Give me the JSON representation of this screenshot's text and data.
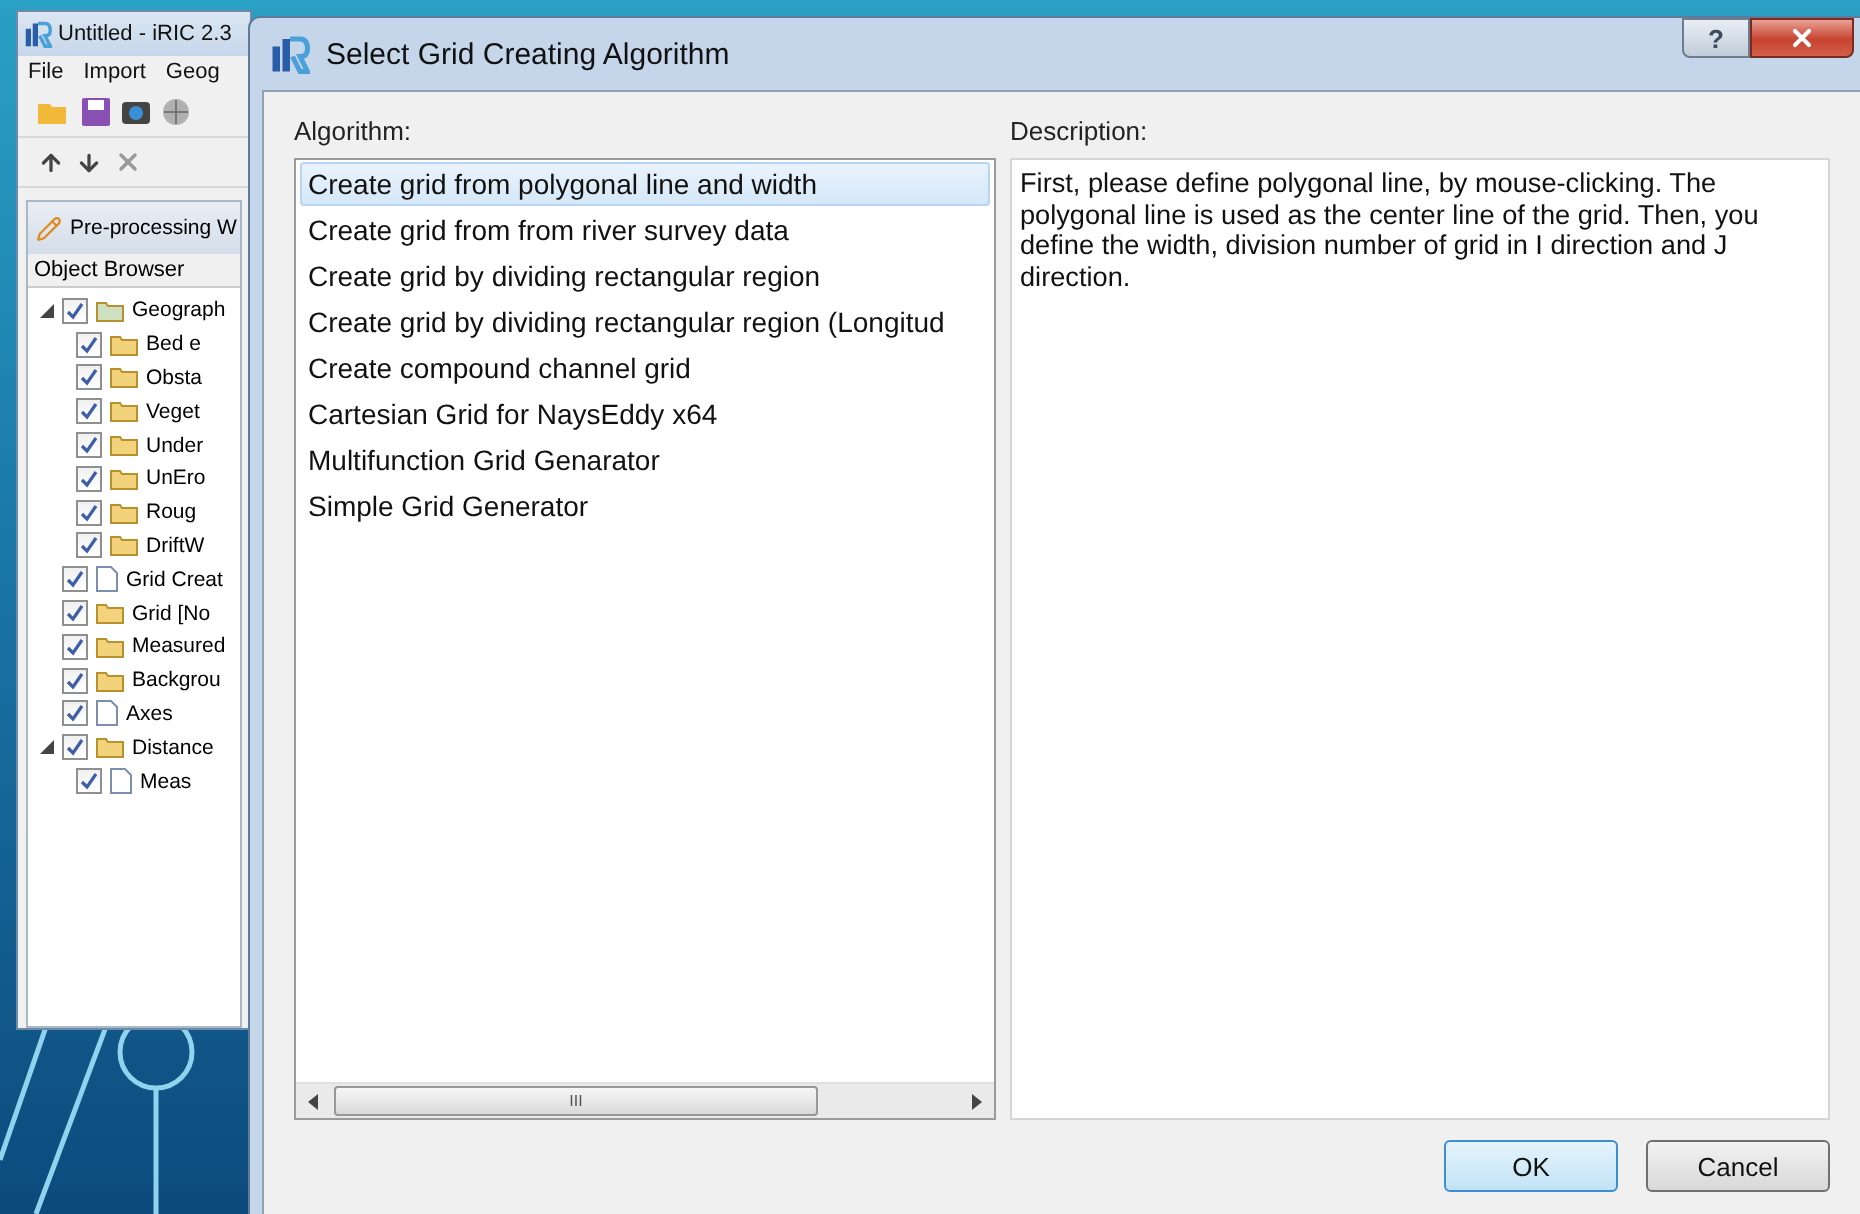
{
  "background_window": {
    "title": "Untitled - iRIC 2.3",
    "menu": [
      "File",
      "Import",
      "Geog"
    ],
    "panel_title": "Pre-processing W",
    "browser_title": "Object Browser",
    "tree": [
      {
        "label": "Geograph",
        "kind": "folder",
        "checked": true,
        "expanded": true,
        "children": [
          {
            "label": "Bed e",
            "kind": "folder",
            "checked": true
          },
          {
            "label": "Obsta",
            "kind": "folder",
            "checked": true
          },
          {
            "label": "Veget",
            "kind": "folder",
            "checked": true
          },
          {
            "label": "Under",
            "kind": "folder",
            "checked": true
          },
          {
            "label": "UnEro",
            "kind": "folder",
            "checked": true
          },
          {
            "label": "Roug",
            "kind": "folder",
            "checked": true
          },
          {
            "label": "DriftW",
            "kind": "folder",
            "checked": true
          }
        ]
      },
      {
        "label": "Grid Creat",
        "kind": "file",
        "checked": true
      },
      {
        "label": "Grid [No",
        "kind": "folder",
        "checked": true
      },
      {
        "label": "Measured",
        "kind": "folder",
        "checked": true
      },
      {
        "label": "Backgrou",
        "kind": "folder",
        "checked": true
      },
      {
        "label": "Axes",
        "kind": "file",
        "checked": true
      },
      {
        "label": "Distance",
        "kind": "folder",
        "checked": true,
        "expanded": true,
        "children": [
          {
            "label": "Meas",
            "kind": "file",
            "checked": true
          }
        ]
      }
    ]
  },
  "dialog": {
    "title": "Select Grid Creating Algorithm",
    "help": "?",
    "algorithm_label": "Algorithm:",
    "description_label": "Description:",
    "algorithms": [
      {
        "label": "Create grid from polygonal line and width",
        "selected": true
      },
      {
        "label": "Create grid from from river survey data",
        "selected": false
      },
      {
        "label": "Create grid by dividing rectangular region",
        "selected": false
      },
      {
        "label": "Create grid by dividing rectangular region (Longitud",
        "selected": false
      },
      {
        "label": "Create compound channel grid",
        "selected": false
      },
      {
        "label": "Cartesian Grid for NaysEddy x64",
        "selected": false
      },
      {
        "label": "Multifunction Grid Genarator",
        "selected": false
      },
      {
        "label": "Simple Grid Generator",
        "selected": false
      }
    ],
    "description": "First, please define polygonal line, by mouse-clicking. The polygonal line is used as the center line of the grid. Then, you define the width, division number of grid in I direction and J direction.",
    "scrollbar_grip": "III",
    "buttons": [
      {
        "label": "OK",
        "default": true
      },
      {
        "label": "Cancel",
        "default": false
      }
    ]
  }
}
